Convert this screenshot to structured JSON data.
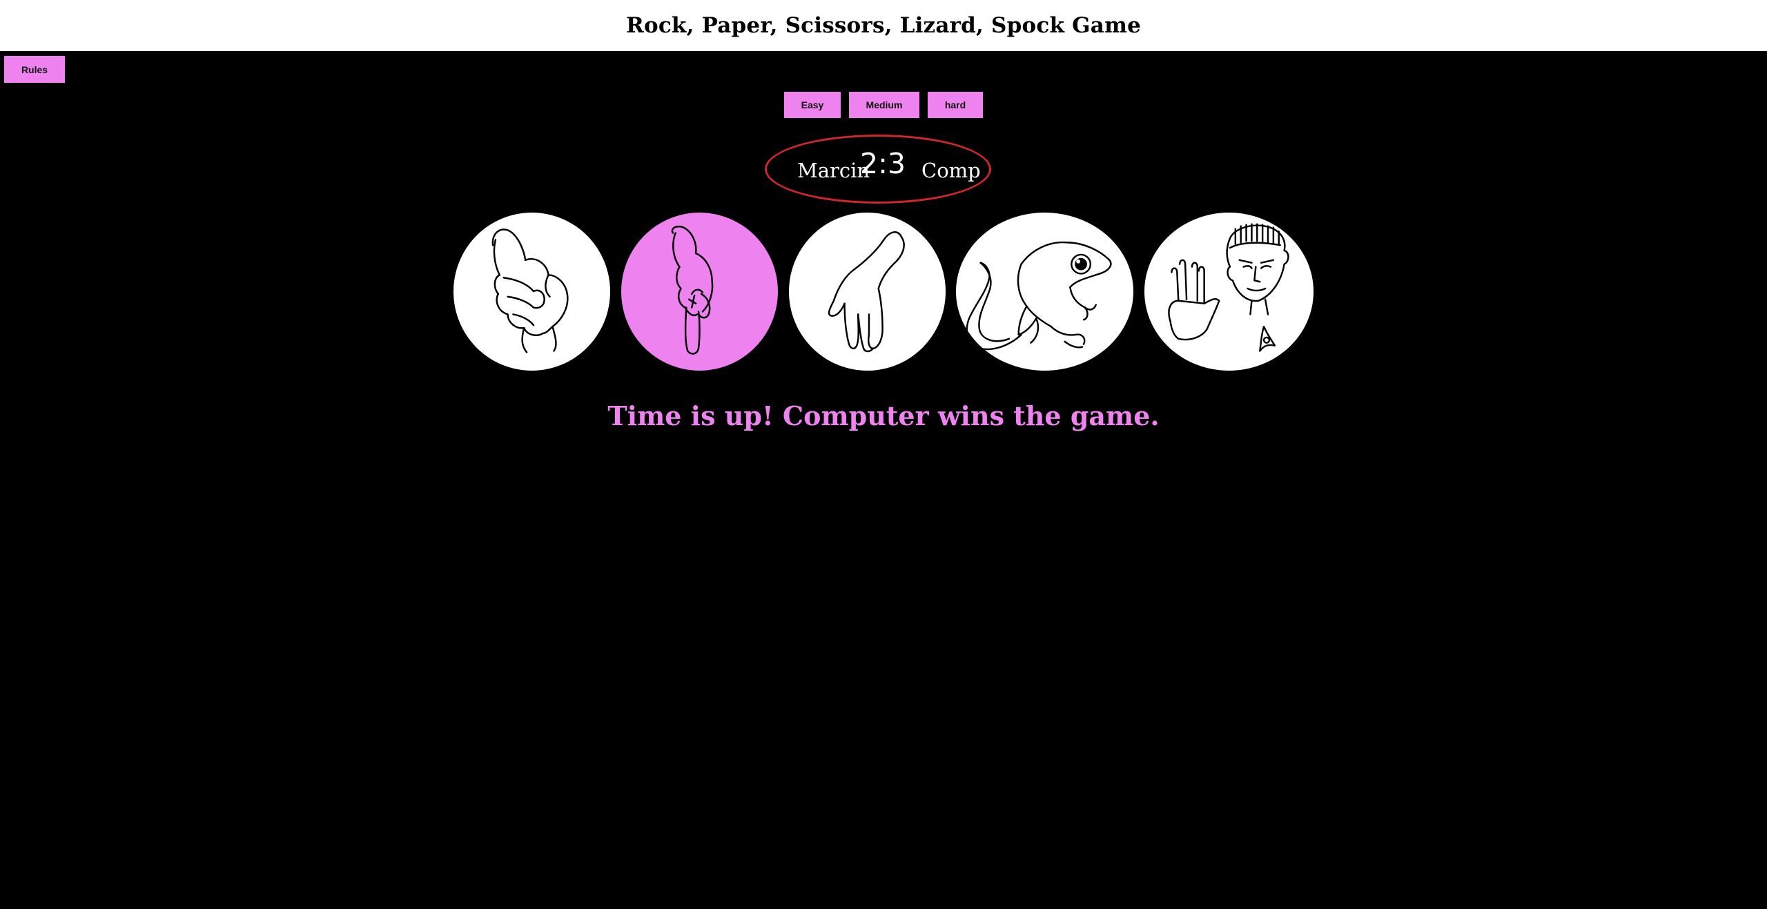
{
  "header": {
    "title": "Rock, Paper, Scissors, Lizard, Spock Game"
  },
  "rules_button": {
    "label": "Rules"
  },
  "difficulty": {
    "easy": "Easy",
    "medium": "Medium",
    "hard": "hard"
  },
  "scoreboard": {
    "player": "Marcin",
    "score": "2:3",
    "opponent": "Comp"
  },
  "choices": [
    {
      "name": "rock",
      "icon": "fist-icon",
      "selected": false
    },
    {
      "name": "paper",
      "icon": "pointing-hand-icon",
      "selected": true
    },
    {
      "name": "scissors",
      "icon": "open-hand-icon",
      "selected": false
    },
    {
      "name": "lizard",
      "icon": "lizard-icon",
      "selected": false
    },
    {
      "name": "spock",
      "icon": "spock-icon",
      "selected": false
    }
  ],
  "colors": {
    "accent": "#ee82ee",
    "background": "#000000",
    "scoreboard_border": "#d0262b"
  },
  "message": "Time is up! Computer wins the game."
}
